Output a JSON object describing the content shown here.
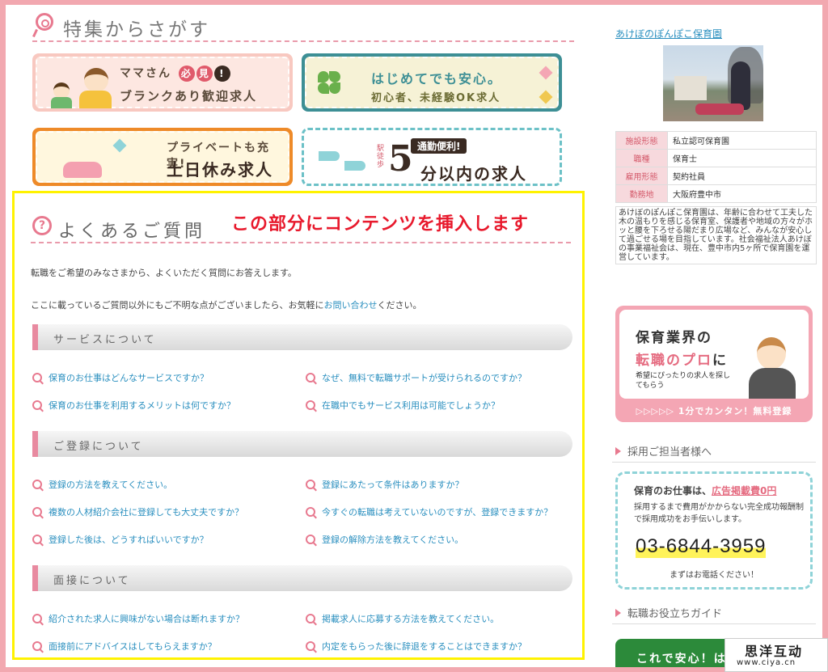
{
  "featured": {
    "title": "特集からさがす",
    "banners": [
      {
        "line1": "ママさん",
        "badges": [
          "必",
          "見",
          "!"
        ],
        "line2": "ブランクあり歓迎求人"
      },
      {
        "line1": "はじめてでも安心。",
        "line2": "初心者、未経験OK求人"
      },
      {
        "line1": "プライベートも充実!",
        "line2": "土日休み求人"
      },
      {
        "tag": "通勤便利!",
        "note": "駅徒歩",
        "big": "5",
        "line2": "分以内の求人"
      }
    ]
  },
  "faq": {
    "title": "よくあるご質問",
    "insert_note": "この部分にコンテンツを挿入します",
    "intro1": "転職をご希望のみなさまから、よくいただく質問にお答えします。",
    "intro2_pre": "ここに載っているご質問以外にもご不明な点がございましたら、お気軽に",
    "intro2_link": "お問い合わせ",
    "intro2_post": "ください。",
    "sections": [
      {
        "title": "サービスについて",
        "questions": [
          "保育のお仕事はどんなサービスですか？",
          "なぜ、無料で転職サポートが受けられるのですか？",
          "保育のお仕事を利用するメリットは何ですか？",
          "在職中でもサービス利用は可能でしょうか？"
        ]
      },
      {
        "title": "ご登録について",
        "questions": [
          "登録の方法を教えてください。",
          "登録にあたって条件はありますか？",
          "複数の人材紹介会社に登録しても大丈夫ですか？",
          "今すぐの転職は考えていないのですが、登録できますか？",
          "登録した後は、どうすればいいですか？",
          "登録の解除方法を教えてください。"
        ]
      },
      {
        "title": "面接について",
        "questions": [
          "紹介された求人に興味がない場合は断れますか？",
          "掲載求人に応募する方法を教えてください。",
          "面接前にアドバイスはしてもらえますか？",
          "内定をもらった後に辞退をすることはできますか？"
        ]
      }
    ]
  },
  "sidebar": {
    "nursery_name": "あけぼのぽんぽこ保育園",
    "info": [
      {
        "key": "施設形態",
        "value": "私立認可保育園"
      },
      {
        "key": "職種",
        "value": "保育士"
      },
      {
        "key": "雇用形態",
        "value": "契約社員"
      },
      {
        "key": "勤務地",
        "value": "大阪府豊中市"
      }
    ],
    "description": "あけぼのぽんぽこ保育園は、年齢に合わせて工夫した木の温もりを感じる保育室、保護者や地域の方々がホッと腰を下ろせる陽だまり広場など、みんなが安心して過ごせる場を目指しています。社会福祉法人あけぼの事業福祉会は、現在、豊中市内5ヶ所で保育園を運営しています。",
    "ad1": {
      "line1": "保育業界の",
      "line2a": "転職のプロ",
      "line2b": "に",
      "line3": "希望にぴったりの求人を探してもらう",
      "bottom": "▷▷▷▷▷ 1分でカンタン！無料登録"
    },
    "head1": "採用ご担当者様へ",
    "ad2": {
      "line1_pre": "保育のお仕事は、",
      "line1_em": "広告掲載費0円",
      "line2": "採用するまで費用がかからない完全成功報酬制で採用成功をお手伝いします。",
      "phone": "03-6844-3959",
      "line3": "まずはお電話ください！"
    },
    "head2": "転職お役立ちガイド",
    "ad3": "これで安心！は"
  },
  "watermark": {
    "line1": "思洋互动",
    "line2": "www.ciya.cn"
  }
}
